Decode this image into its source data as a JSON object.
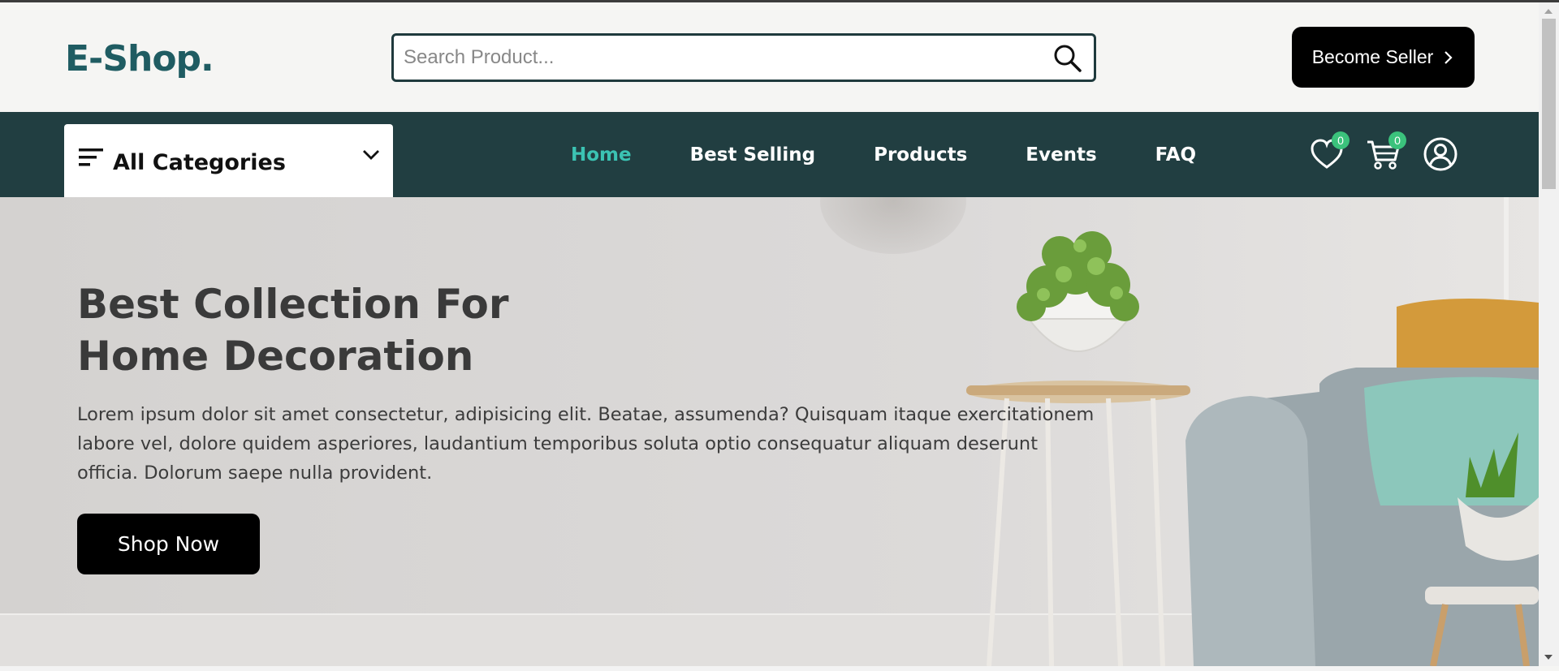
{
  "header": {
    "logo": "E-Shop.",
    "search": {
      "placeholder": "Search Product...",
      "value": ""
    },
    "seller_button": "Become Seller"
  },
  "navbar": {
    "categories_label": "All Categories",
    "links": [
      {
        "label": "Home",
        "active": true
      },
      {
        "label": "Best Selling",
        "active": false
      },
      {
        "label": "Products",
        "active": false
      },
      {
        "label": "Events",
        "active": false
      },
      {
        "label": "FAQ",
        "active": false
      }
    ],
    "wishlist_count": "0",
    "cart_count": "0",
    "icons": [
      "heart-icon",
      "cart-icon",
      "user-icon"
    ]
  },
  "hero": {
    "title_line1": "Best Collection For",
    "title_line2": "Home Decoration",
    "description": "Lorem ipsum dolor sit amet consectetur, adipisicing elit. Beatae, assumenda? Quisquam itaque exercitationem labore vel, dolore quidem asperiores, laudantium temporibus soluta optio consequatur aliquam deserunt officia. Dolorum saepe nulla provident.",
    "cta": "Shop Now"
  },
  "colors": {
    "brand": "#1f5c62",
    "navbar": "#213e41",
    "active_link": "#3bc3b3",
    "badge": "#3bc27c",
    "button": "#000000"
  }
}
